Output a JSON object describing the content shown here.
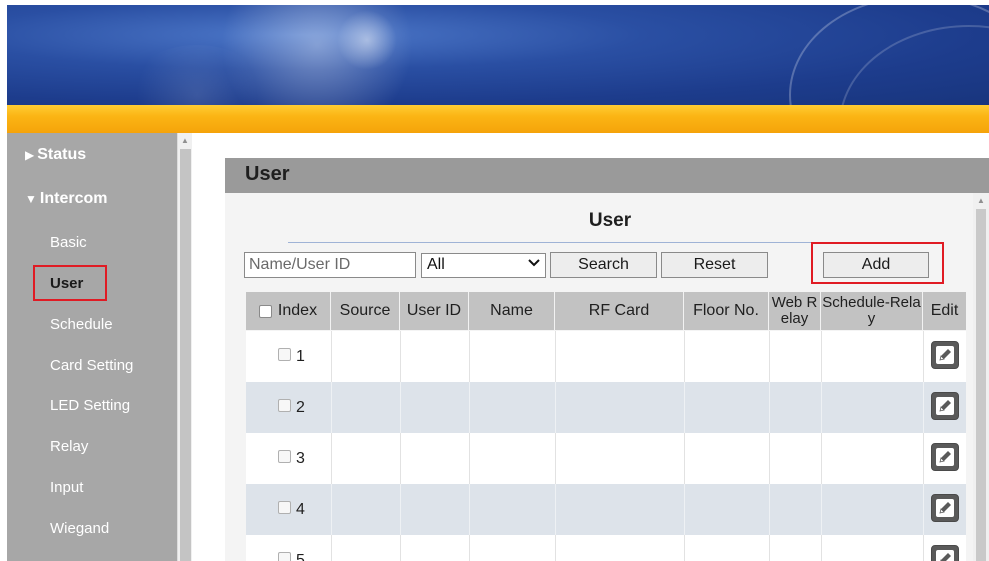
{
  "sidebar": {
    "sections": [
      {
        "label": "Status",
        "expanded": false
      },
      {
        "label": "Intercom",
        "expanded": true
      }
    ],
    "items": [
      {
        "label": "Basic"
      },
      {
        "label": "User",
        "active": true
      },
      {
        "label": "Schedule"
      },
      {
        "label": "Card Setting"
      },
      {
        "label": "LED Setting"
      },
      {
        "label": "Relay"
      },
      {
        "label": "Input"
      },
      {
        "label": "Wiegand"
      }
    ]
  },
  "panel": {
    "title": "User",
    "section_title": "User"
  },
  "toolbar": {
    "search_placeholder": "Name/User ID",
    "filter_value": "All",
    "search_label": "Search",
    "reset_label": "Reset",
    "add_label": "Add"
  },
  "table": {
    "columns": {
      "index": "Index",
      "source": "Source",
      "user_id": "User ID",
      "name": "Name",
      "rf_card": "RF Card",
      "floor_no": "Floor No.",
      "web_relay_1": "Web R",
      "web_relay_2": "elay",
      "schedule_relay_1": "Schedule-Rela",
      "schedule_relay_2": "y",
      "edit": "Edit"
    },
    "rows": [
      {
        "index": "1"
      },
      {
        "index": "2"
      },
      {
        "index": "3"
      },
      {
        "index": "4"
      },
      {
        "index": "5"
      }
    ]
  },
  "colors": {
    "banner_blue": "#1d3c8c",
    "accent_orange": "#fbb514",
    "sidebar_gray": "#a7a7a7",
    "highlight_red": "#e01b24"
  },
  "icons": {
    "edit": "pencil-edit-icon",
    "expand_collapsed": "triangle-right-icon",
    "expand_open": "triangle-down-icon"
  }
}
